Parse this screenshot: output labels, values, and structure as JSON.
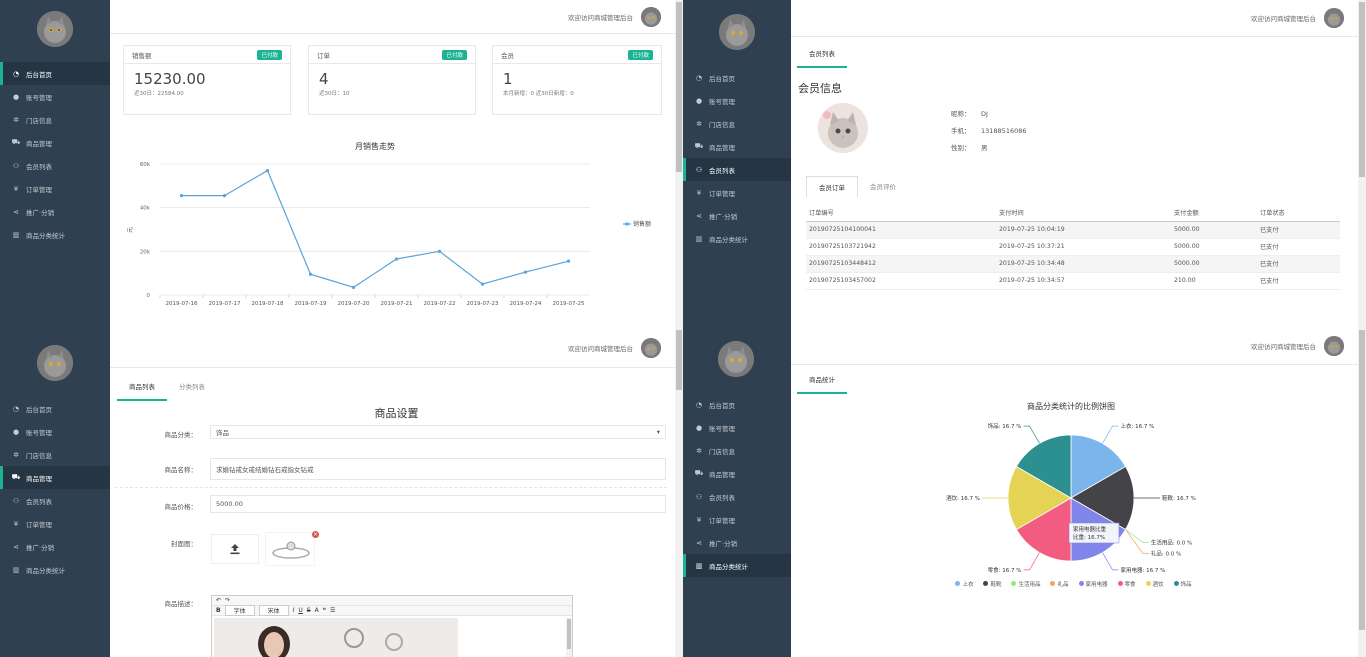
{
  "topbar": {
    "welcome": "欢迎访问商城管理后台"
  },
  "nav": [
    {
      "label": "后台首页",
      "icon": "dashboard-icon"
    },
    {
      "label": "账号管理",
      "icon": "user-icon"
    },
    {
      "label": "门店信息",
      "icon": "gear-icon"
    },
    {
      "label": "商品管理",
      "icon": "cart-icon"
    },
    {
      "label": "会员列表",
      "icon": "users-icon"
    },
    {
      "label": "订单管理",
      "icon": "yen-icon"
    },
    {
      "label": "推广·分销",
      "icon": "share-icon"
    },
    {
      "label": "商品分类统计",
      "icon": "bar-chart-icon"
    }
  ],
  "dashboard": {
    "cards": [
      {
        "title": "销售额",
        "badge": "已付款",
        "value": "15230.00",
        "sub": "近30日：22584.00"
      },
      {
        "title": "订单",
        "badge": "已付款",
        "value": "4",
        "sub": "近30日：10"
      },
      {
        "title": "会员",
        "badge": "已付款",
        "value": "1",
        "sub": "本月新增：0  近30日新增：0"
      }
    ],
    "chart_data": {
      "type": "line",
      "title": "月销售走势",
      "ylabel": "元",
      "x": [
        "2019-07-16",
        "2019-07-17",
        "2019-07-18",
        "2019-07-19",
        "2019-07-20",
        "2019-07-21",
        "2019-07-22",
        "2019-07-23",
        "2019-07-24",
        "2019-07-25"
      ],
      "series": [
        {
          "name": "销售额",
          "values": [
            45500,
            45500,
            57000,
            9500,
            3500,
            16500,
            20000,
            5000,
            10500,
            15500
          ]
        }
      ],
      "yticks": [
        "0",
        "20k",
        "40k",
        "60k"
      ],
      "ylim": [
        0,
        60000
      ],
      "color": "#5aa3db"
    }
  },
  "member": {
    "tab": "会员列表",
    "heading": "会员信息",
    "fields": [
      {
        "label": "昵称：",
        "value": "DJ"
      },
      {
        "label": "手机：",
        "value": "13188516086"
      },
      {
        "label": "性别：",
        "value": "男"
      }
    ],
    "subtabs": [
      "会员订单",
      "会员评价"
    ],
    "columns": [
      "订单编号",
      "支付时间",
      "支付金额",
      "订单状态"
    ],
    "rows": [
      [
        "20190725104100041",
        "2019-07-25 10:04:19",
        "5000.00",
        "已支付"
      ],
      [
        "20190725103721942",
        "2019-07-25 10:37:21",
        "5000.00",
        "已支付"
      ],
      [
        "20190725103448412",
        "2019-07-25 10:34:48",
        "5000.00",
        "已支付"
      ],
      [
        "20190725103457002",
        "2019-07-25 10:34:57",
        "210.00",
        "已支付"
      ]
    ]
  },
  "product": {
    "tabs": [
      "商品列表",
      "分类列表"
    ],
    "heading": "商品设置",
    "fields": {
      "category_label": "商品分类：",
      "category_value": "饰品",
      "name_label": "商品名称：",
      "name_value": "求婚钻戒女戒结婚钻石戒指女钻戒",
      "price_label": "商品价格：",
      "price_value": "5000.00",
      "image_label": "封面图：",
      "desc_label": "商品描述："
    },
    "editor": {
      "font_family": "字体",
      "font_name": "宋体"
    }
  },
  "stats": {
    "tab": "商品统计",
    "chart_data": {
      "type": "pie",
      "title": "商品分类统计的比例饼图",
      "tooltip": {
        "line1": "家用电器比重",
        "line2": "比重: 16.7%"
      },
      "slices": [
        {
          "name": "上衣",
          "value": 16.7,
          "color": "#7cb5ec",
          "label": "上衣: 16.7 %"
        },
        {
          "name": "鞋靴",
          "value": 16.7,
          "color": "#434348",
          "label": "鞋靴: 16.7 %"
        },
        {
          "name": "生活用品",
          "value": 0.0,
          "color": "#90ed7d",
          "label": "生活用品: 0.0 %"
        },
        {
          "name": "礼品",
          "value": 0.0,
          "color": "#f7a35c",
          "label": "礼品: 0.0 %"
        },
        {
          "name": "家用电器",
          "value": 16.7,
          "color": "#8085e9",
          "label": "家用电器: 16.7 %"
        },
        {
          "name": "零食",
          "value": 16.7,
          "color": "#f15c80",
          "label": "零食: 16.7 %"
        },
        {
          "name": "酒饮",
          "value": 16.7,
          "color": "#e4d354",
          "label": "酒饮: 16.7 %"
        },
        {
          "name": "饰品",
          "value": 16.7,
          "color": "#2b908f",
          "label": "饰品: 16.7 %"
        }
      ]
    }
  }
}
